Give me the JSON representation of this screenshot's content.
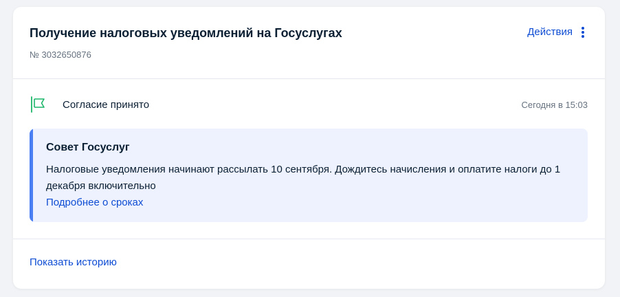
{
  "order": {
    "title": "Получение налоговых уведомлений на Госуслугах",
    "number": "№ 3032650876",
    "actions_label": "Действия"
  },
  "status": {
    "icon": "flag-icon",
    "label": "Согласие принято",
    "time": "Сегодня в 15:03"
  },
  "advice": {
    "title": "Совет Госуслуг",
    "text": "Налоговые уведомления начинают рассылать 10 сентября. Дождитесь начисления и оплатите налоги до 1 декабря включительно",
    "link": "Подробнее о сроках"
  },
  "footer": {
    "history_link": "Показать историю"
  },
  "colors": {
    "link": "#0d4cd3",
    "status_green": "#1db56a",
    "advice_background": "#edf2fe",
    "advice_accent": "#4a7ef3",
    "muted_text": "#66727f"
  }
}
